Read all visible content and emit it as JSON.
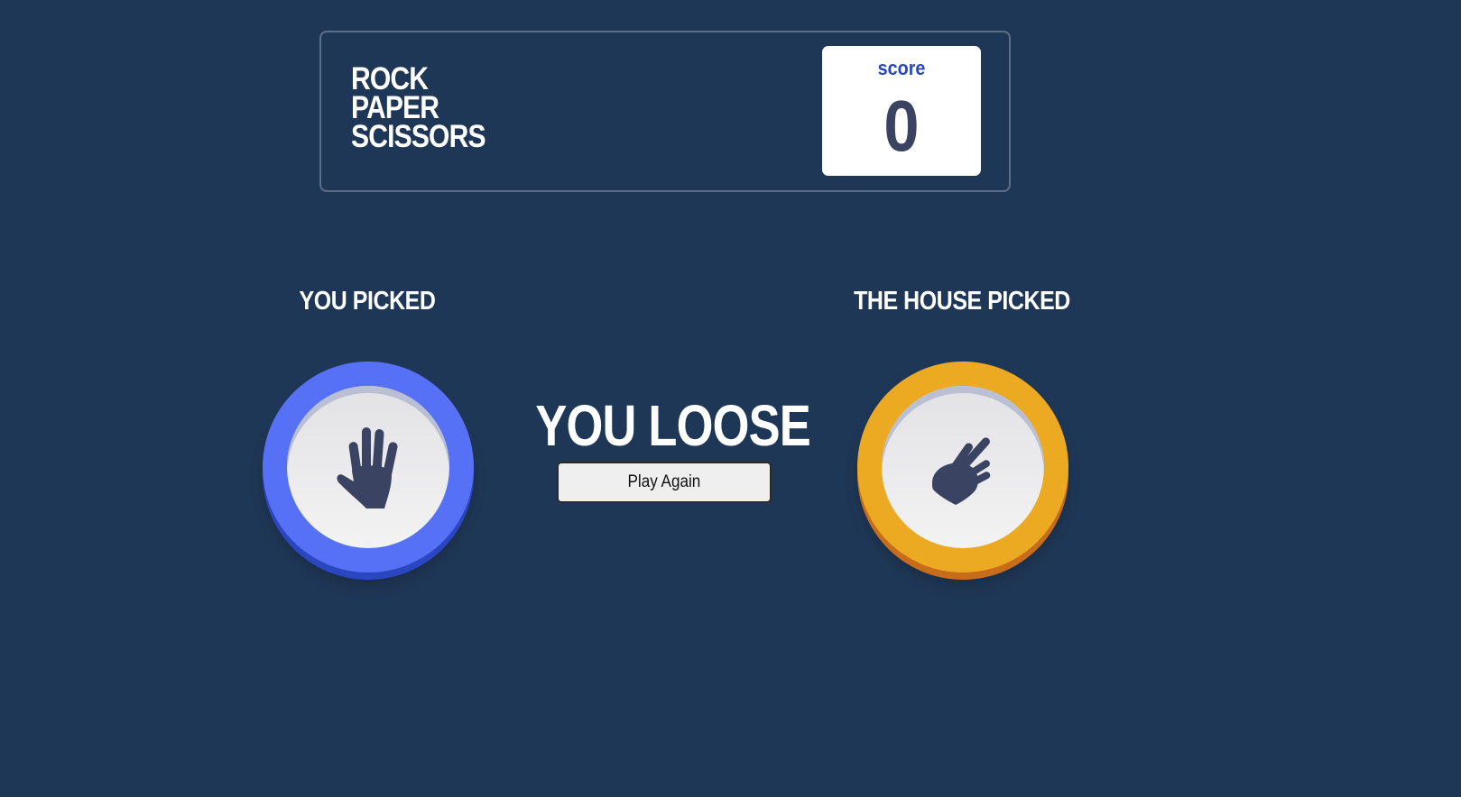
{
  "header": {
    "title_lines": [
      "ROCK",
      "PAPER",
      "SCISSORS"
    ],
    "score_label": "score",
    "score_value": "0"
  },
  "game": {
    "you_picked_label": "YOU PICKED",
    "house_picked_label": "THE HOUSE PICKED",
    "player_choice": "paper",
    "house_choice": "scissors",
    "result_text": "YOU LOOSE",
    "play_again_label": "Play Again"
  },
  "colors": {
    "background": "#1f3756",
    "paper": "#5671f5",
    "scissors": "#eca922",
    "score_label": "#2a46c0",
    "score_value": "#3b4363",
    "icon": "#3b4363"
  },
  "icons": {
    "player": "hand-paper-icon",
    "house": "hand-scissors-icon"
  }
}
